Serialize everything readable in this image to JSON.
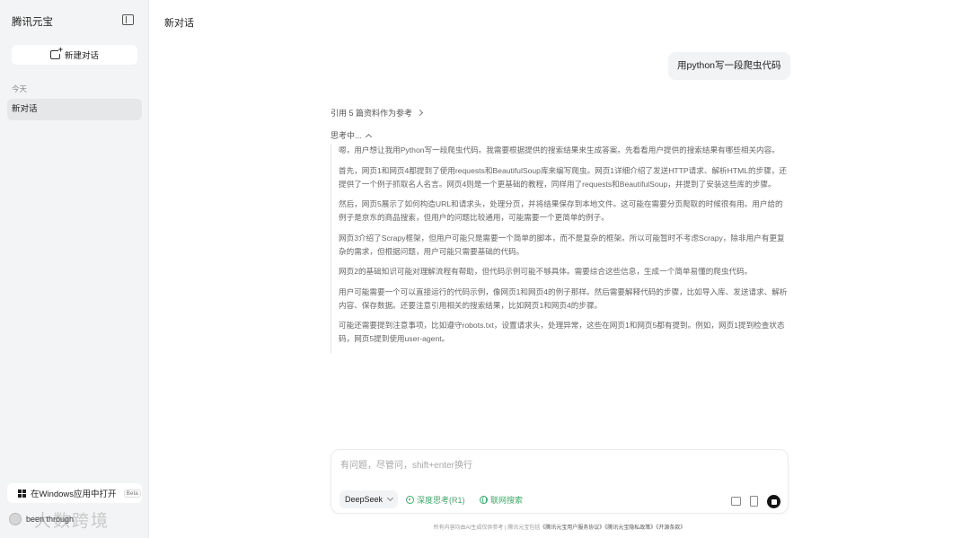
{
  "sidebar": {
    "app_title": "腾讯元宝",
    "new_chat_label": "新建对话",
    "section_today": "今天",
    "conversations": [
      "新对话"
    ],
    "open_in_windows": "在Windows应用中打开",
    "beta": "Beta",
    "user_name": "been through"
  },
  "watermark": "大数跨境",
  "main": {
    "title": "新对话",
    "user_message": "用python写一段爬虫代码",
    "references_label": "引用 5 篇资料作为参考",
    "thinking_label": "思考中...",
    "thinking_paragraphs": [
      "嗯，用户想让我用Python写一段爬虫代码。我需要根据提供的搜索结果来生成答案。先看看用户提供的搜索结果有哪些相关内容。",
      "首先，网页1和网页4都提到了使用requests和BeautifulSoup库来编写爬虫。网页1详细介绍了发送HTTP请求、解析HTML的步骤，还提供了一个例子抓取名人名言。网页4则是一个更基础的教程，同样用了requests和BeautifulSoup，并提到了安装这些库的步骤。",
      "然后，网页5展示了如何构造URL和请求头，处理分页，并将结果保存到本地文件。这可能在需要分页爬取的时候很有用。用户给的例子是京东的商品搜索，但用户的问题比较通用，可能需要一个更简单的例子。",
      "网页3介绍了Scrapy框架，但用户可能只是需要一个简单的脚本，而不是复杂的框架。所以可能暂时不考虑Scrapy，除非用户有更复杂的需求，但根据问题，用户可能只需要基础的代码。",
      "网页2的基础知识可能对理解流程有帮助，但代码示例可能不够具体。需要综合这些信息，生成一个简单易懂的爬虫代码。",
      "用户可能需要一个可以直接运行的代码示例，像网页1和网页4的例子那样。然后需要解释代码的步骤，比如导入库、发送请求、解析内容、保存数据。还要注意引用相关的搜索结果，比如网页1和网页4的步骤。",
      "可能还需要提到注意事项，比如遵守robots.txt，设置请求头，处理异常，这些在网页1和网页5都有提到。例如，网页1提到检查状态码，网页5提到使用user-agent。"
    ]
  },
  "input": {
    "placeholder": "有问题，尽管问，shift+enter换行",
    "model": "DeepSeek",
    "deep_think": "深度思考(R1)",
    "web_search": "联网搜索"
  },
  "footer": {
    "disclaimer": "所有内容均由AI生成仅供参考",
    "separator": "|",
    "prefix": "腾讯元宝包括",
    "link1": "《腾讯元宝用户服务协议》",
    "link2": "《腾讯元宝隐私政策》",
    "link3": "《开源条款》"
  },
  "colors": {
    "accent_green": "#3fa86a",
    "sidebar_bg": "#f3f4f5",
    "active_item_bg": "#e6e7e9"
  }
}
